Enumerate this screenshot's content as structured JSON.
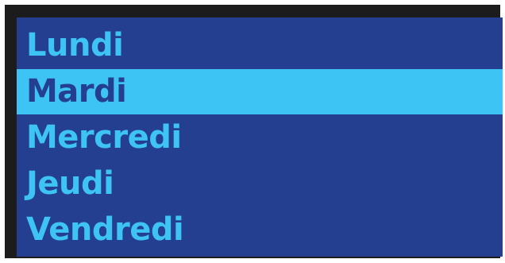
{
  "listbox": {
    "items": [
      {
        "label": "Lundi"
      },
      {
        "label": "Mardi"
      },
      {
        "label": "Mercredi"
      },
      {
        "label": "Jeudi"
      },
      {
        "label": "Vendredi"
      }
    ],
    "selected_label": "Mardi"
  },
  "colors": {
    "frame": "#1c1c1c",
    "list_background": "#243f8f",
    "item_text": "#3ec3f5",
    "selection_background": "#3ec3f5",
    "selection_text": "#243f8f"
  }
}
